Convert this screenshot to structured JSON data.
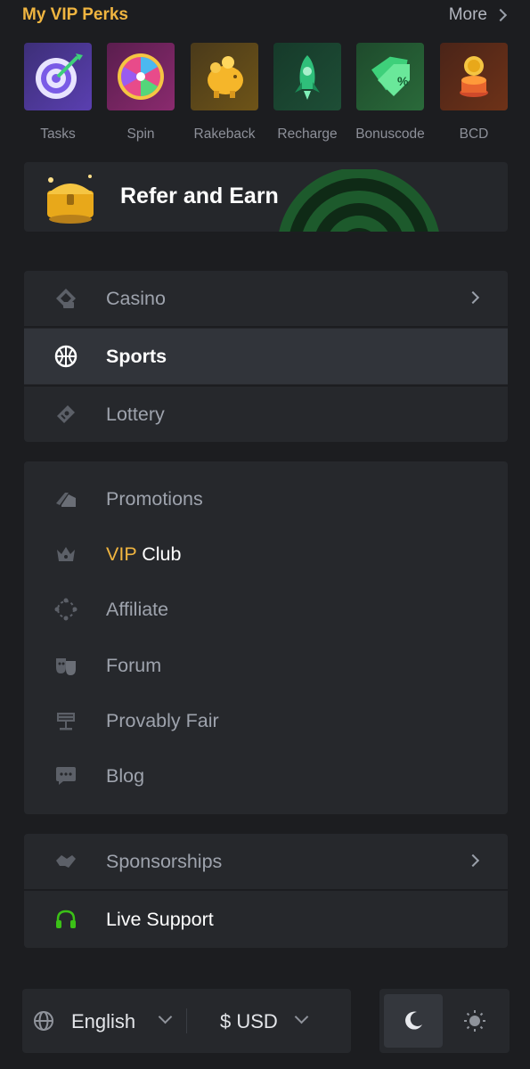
{
  "perks": {
    "title": "My VIP Perks",
    "more_label": "More",
    "items": [
      {
        "label": "Tasks",
        "icon": "target-dart-icon"
      },
      {
        "label": "Spin",
        "icon": "prize-wheel-icon"
      },
      {
        "label": "Rakeback",
        "icon": "piggy-bank-icon"
      },
      {
        "label": "Recharge",
        "icon": "rocket-icon"
      },
      {
        "label": "Bonuscode",
        "icon": "discount-tag-icon"
      },
      {
        "label": "BCD",
        "icon": "coin-stack-icon"
      }
    ]
  },
  "refer": {
    "label": "Refer and Earn",
    "icon": "treasure-chest-icon"
  },
  "games": [
    {
      "label": "Casino",
      "icon": "casino-chip-icon",
      "has_arrow": true,
      "active": false
    },
    {
      "label": "Sports",
      "icon": "basketball-icon",
      "has_arrow": false,
      "active": true
    },
    {
      "label": "Lottery",
      "icon": "lottery-ticket-icon",
      "has_arrow": false,
      "active": false
    }
  ],
  "links": [
    {
      "label": "Promotions",
      "icon": "tags-icon"
    },
    {
      "label_vip": "VIP",
      "label_rest": " Club",
      "icon": "crown-icon"
    },
    {
      "label": "Affiliate",
      "icon": "network-icon"
    },
    {
      "label": "Forum",
      "icon": "masks-icon"
    },
    {
      "label": "Provably Fair",
      "icon": "scale-icon"
    },
    {
      "label": "Blog",
      "icon": "chat-bubble-icon"
    }
  ],
  "extra": [
    {
      "label": "Sponsorships",
      "icon": "handshake-icon",
      "has_arrow": true
    },
    {
      "label": "Live Support",
      "icon": "headset-icon",
      "has_arrow": false
    }
  ],
  "footer": {
    "language": "English",
    "currency": "$ USD",
    "theme": {
      "selected": "dark",
      "options": [
        "moon-icon",
        "sun-icon"
      ]
    }
  },
  "colors": {
    "accent": "#f0b540",
    "support_green": "#3bc117",
    "background": "#1c1d20",
    "panel": "#26282c"
  }
}
